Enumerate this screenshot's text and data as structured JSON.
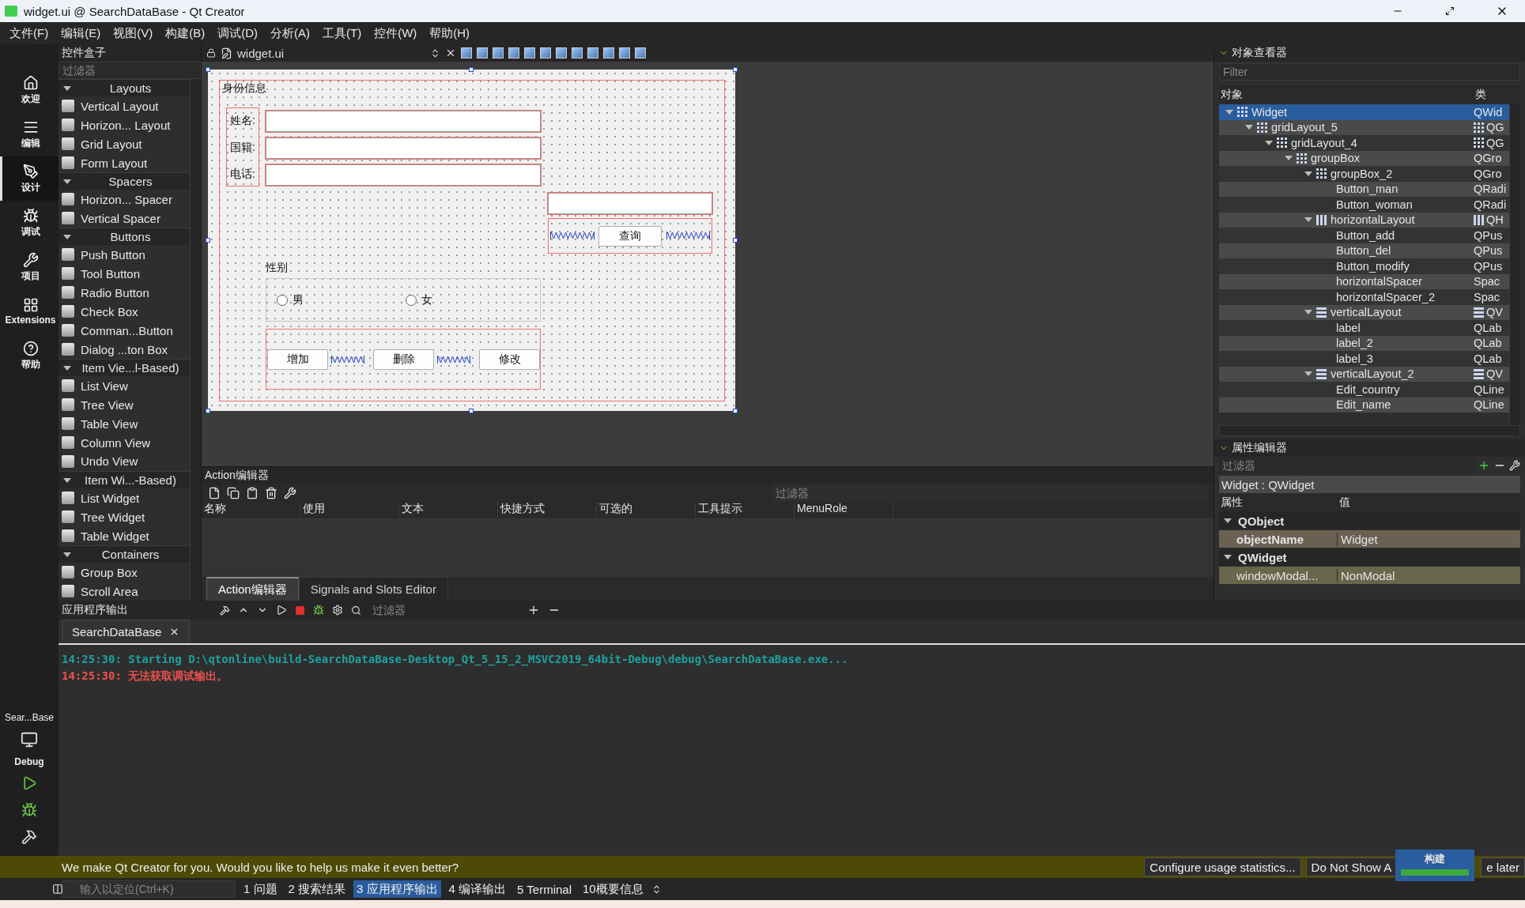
{
  "window": {
    "title": "widget.ui @ SearchDataBase - Qt Creator"
  },
  "menu": [
    "文件(F)",
    "编辑(E)",
    "视图(V)",
    "构建(B)",
    "调试(D)",
    "分析(A)",
    "工具(T)",
    "控件(W)",
    "帮助(H)"
  ],
  "mode_bar": {
    "items": [
      {
        "label": "欢迎",
        "selected": false
      },
      {
        "label": "编辑",
        "selected": false
      },
      {
        "label": "设计",
        "selected": true
      },
      {
        "label": "调试",
        "selected": false
      },
      {
        "label": "项目",
        "selected": false
      },
      {
        "label": "Extensions",
        "selected": false
      },
      {
        "label": "帮助",
        "selected": false
      }
    ],
    "project": "Sear...Base",
    "build": "Debug"
  },
  "widget_box": {
    "title": "控件盒子",
    "filter_placeholder": "过滤器",
    "categories": [
      {
        "name": "Layouts",
        "expanded": true,
        "items": [
          "Vertical Layout",
          "Horizon... Layout",
          "Grid Layout",
          "Form Layout"
        ]
      },
      {
        "name": "Spacers",
        "expanded": true,
        "items": [
          "Horizon... Spacer",
          "Vertical Spacer"
        ]
      },
      {
        "name": "Buttons",
        "expanded": true,
        "items": [
          "Push Button",
          "Tool Button",
          "Radio Button",
          "Check Box",
          "Comman...Button",
          "Dialog ...ton Box"
        ]
      },
      {
        "name": "Item Vie...l-Based)",
        "expanded": true,
        "items": [
          "List View",
          "Tree View",
          "Table View",
          "Column View",
          "Undo View"
        ]
      },
      {
        "name": "Item Wi...-Based)",
        "expanded": true,
        "items": [
          "List Widget",
          "Tree Widget",
          "Table Widget"
        ]
      },
      {
        "name": "Containers",
        "expanded": true,
        "items": [
          "Group Box",
          "Scroll Area"
        ]
      }
    ]
  },
  "editor": {
    "file": "widget.ui",
    "form": {
      "group_title": "身份信息",
      "fields": [
        {
          "label": "姓名:"
        },
        {
          "label": "国籍:"
        },
        {
          "label": "电话:"
        }
      ],
      "search_button": "查询",
      "gender_label": "性别",
      "radios": [
        {
          "label": "男",
          "checked": false
        },
        {
          "label": "女",
          "checked": false
        }
      ],
      "buttons": [
        "增加",
        "删除",
        "修改"
      ]
    }
  },
  "action_editor": {
    "title": "Action编辑器",
    "filter_placeholder": "过滤器",
    "columns": [
      "名称",
      "使用",
      "文本",
      "快捷方式",
      "可选的",
      "工具提示",
      "MenuRole"
    ],
    "tabs": [
      {
        "label": "Action编辑器",
        "selected": true
      },
      {
        "label": "Signals and Slots Editor",
        "selected": false
      }
    ]
  },
  "object_inspector": {
    "title": "对象查看器",
    "filter_placeholder": "Filter",
    "columns": [
      "对象",
      "类"
    ],
    "tree": [
      {
        "name": "Widget",
        "class": "QWid",
        "kind": "grid",
        "layout": false,
        "expanded": true,
        "selected": true,
        "children": [
          {
            "name": "gridLayout_5",
            "class": "QG",
            "kind": "grid",
            "layout": true,
            "expanded": true,
            "selected": false,
            "children": [
              {
                "name": "gridLayout_4",
                "class": "QG",
                "kind": "grid",
                "layout": true,
                "expanded": true,
                "selected": false,
                "children": [
                  {
                    "name": "groupBox",
                    "class": "QGro",
                    "kind": "grid",
                    "layout": false,
                    "expanded": true,
                    "selected": false,
                    "children": [
                      {
                        "name": "groupBox_2",
                        "class": "QGro",
                        "kind": "grid",
                        "layout": false,
                        "expanded": true,
                        "selected": false,
                        "children": [
                          {
                            "name": "Button_man",
                            "class": "QRadi",
                            "selected": false
                          },
                          {
                            "name": "Button_woman",
                            "class": "QRadi",
                            "selected": false
                          }
                        ]
                      },
                      {
                        "name": "horizontalLayout",
                        "class": "QH",
                        "kind": "hbox",
                        "layout": true,
                        "expanded": true,
                        "selected": false,
                        "children": [
                          {
                            "name": "Button_add",
                            "class": "QPus",
                            "selected": false
                          },
                          {
                            "name": "Button_del",
                            "class": "QPus",
                            "selected": false
                          },
                          {
                            "name": "Button_modify",
                            "class": "QPus",
                            "selected": false
                          },
                          {
                            "name": "horizontalSpacer",
                            "class": "Spac",
                            "selected": false
                          },
                          {
                            "name": "horizontalSpacer_2",
                            "class": "Spac",
                            "selected": false
                          }
                        ]
                      },
                      {
                        "name": "verticalLayout",
                        "class": "QV",
                        "kind": "vbox",
                        "layout": true,
                        "expanded": true,
                        "selected": false,
                        "children": [
                          {
                            "name": "label",
                            "class": "QLab",
                            "selected": false
                          },
                          {
                            "name": "label_2",
                            "class": "QLab",
                            "selected": false
                          },
                          {
                            "name": "label_3",
                            "class": "QLab",
                            "selected": false
                          }
                        ]
                      },
                      {
                        "name": "verticalLayout_2",
                        "class": "QV",
                        "kind": "vbox",
                        "layout": true,
                        "expanded": true,
                        "selected": false,
                        "children": [
                          {
                            "name": "Edit_country",
                            "class": "QLine",
                            "selected": false
                          },
                          {
                            "name": "Edit_name",
                            "class": "QLine",
                            "selected": false
                          }
                        ]
                      }
                    ]
                  }
                ]
              }
            ]
          }
        ]
      }
    ]
  },
  "property_editor": {
    "title": "属性编辑器",
    "filter_placeholder": "过滤器",
    "object": "Widget : QWidget",
    "columns": [
      "属性",
      "值"
    ],
    "rows": [
      {
        "kind": "section",
        "name": "QObject",
        "expanded": true
      },
      {
        "kind": "property",
        "name": "objectName",
        "value": "Widget",
        "modified": true,
        "color": "#6b6152"
      },
      {
        "kind": "section",
        "name": "QWidget",
        "expanded": true
      },
      {
        "kind": "property",
        "name": "windowModal...",
        "value": "NonModal",
        "modified": false,
        "color": "#67674c"
      }
    ]
  },
  "output": {
    "title": "应用程序输出",
    "filter_placeholder": "过滤器",
    "tab": "SearchDataBase",
    "lines": [
      {
        "kind": "info",
        "text": "14:25:30: Starting D:\\qtonline\\build-SearchDataBase-Desktop_Qt_5_15_2_MSVC2019_64bit-Debug\\debug\\SearchDataBase.exe..."
      },
      {
        "kind": "error",
        "text": "14:25:30: 无法获取调试输出。"
      }
    ]
  },
  "info_bar": {
    "message": "We make Qt Creator for you. Would you like to help us make it even better?",
    "buttons": [
      "Configure usage statistics...",
      "Do Not Show A",
      "e later"
    ]
  },
  "build_popup": {
    "title": "构建",
    "level": 1
  },
  "status_bar": {
    "locator_placeholder": "输入以定位(Ctrl+K)",
    "tabs": [
      {
        "label": "1 问题",
        "selected": false
      },
      {
        "label": "2 搜索结果",
        "selected": false
      },
      {
        "label": "3 应用程序输出",
        "selected": true
      },
      {
        "label": "4 编译输出",
        "selected": false
      },
      {
        "label": "5 Terminal",
        "selected": false
      },
      {
        "label": "10概要信息",
        "selected": false
      }
    ]
  }
}
